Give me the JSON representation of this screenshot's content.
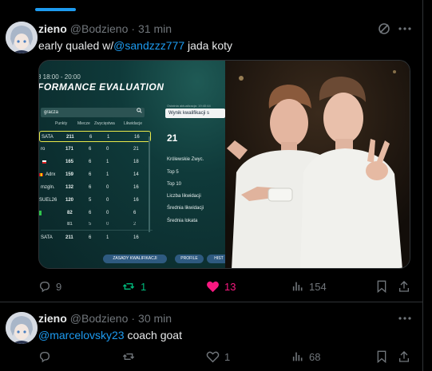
{
  "tweets": [
    {
      "name": "zieno",
      "handle": "@Bodzieno",
      "separator": "·",
      "time": "31 min",
      "text_before": "early qualed w/",
      "mention": "@sandzzz777",
      "text_after": "  jada koty",
      "stats": {
        "replies": "9",
        "retweets": "1",
        "likes": "13",
        "views": "154"
      },
      "media": {
        "screenshot": {
          "date": "8 18:00 - 20:00",
          "title": "FORMANCE EVALUATION",
          "search_placeholder": "gracza",
          "search_icon": "magnifier-icon",
          "columns": [
            "Punkty",
            "Miecze",
            "Zwycięstwa",
            "Likwidacje"
          ],
          "rows": [
            {
              "name": "SATA",
              "points": "211",
              "c2": "6",
              "c3": "1",
              "c4": "16",
              "highlight": true
            },
            {
              "name": "ro",
              "points": "171",
              "c2": "6",
              "c3": "0",
              "c4": "21"
            },
            {
              "name": "",
              "points": "165",
              "c2": "6",
              "c3": "1",
              "c4": "18"
            },
            {
              "name": "Adrx",
              "points": "159",
              "c2": "6",
              "c3": "1",
              "c4": "14"
            },
            {
              "name": "mzgln.",
              "points": "132",
              "c2": "6",
              "c3": "0",
              "c4": "16"
            },
            {
              "name": "SUEL26",
              "points": "120",
              "c2": "5",
              "c3": "0",
              "c4": "16"
            },
            {
              "name": "",
              "points": "82",
              "c2": "6",
              "c3": "0",
              "c4": "6"
            },
            {
              "name": "",
              "points": "81",
              "c2": "5",
              "c3": "0",
              "c4": "2"
            },
            {
              "name": "SATA",
              "points": "211",
              "c2": "6",
              "c3": "1",
              "c4": "16"
            }
          ],
          "side_note": "Ostatnia aktualizacja: 19:40:44",
          "side_select": "Wynik kwalifikacji s",
          "side_big": "21",
          "side_labels": [
            "Królewskie Zwyc.",
            "Top 5",
            "Top 10",
            "Liczba likwidacji",
            "Średnia likwidacji",
            "Średnia lokata"
          ],
          "buttons": [
            "ZASADY KWALIFIKACJI",
            "PROFILE",
            "HIST"
          ]
        }
      }
    },
    {
      "name": "zieno",
      "handle": "@Bodzieno",
      "separator": "·",
      "time": "30 min",
      "mention": "@marcelovsky23",
      "text_after": "  coach goat",
      "stats": {
        "replies": "",
        "retweets": "",
        "likes": "1",
        "views": "68"
      }
    }
  ],
  "colors": {
    "accent": "#1d9bf0",
    "like": "#f91880",
    "retweet": "#00ba7c",
    "muted": "#71767b"
  }
}
